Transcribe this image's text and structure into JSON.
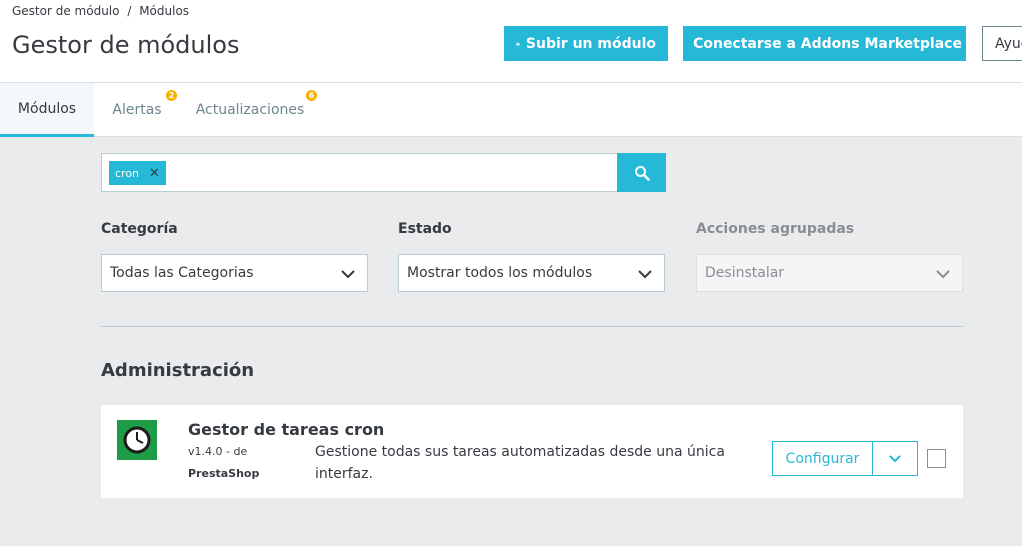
{
  "breadcrumb": [
    "Gestor de módulo",
    "/",
    "Módulos"
  ],
  "header": {
    "title": "Gestor de módulos",
    "upload_label": "Subir un módulo",
    "addons_label": "Conectarse a Addons Marketplace",
    "help_label": "Ayuda"
  },
  "tabs": [
    {
      "label": "Módulos",
      "active": true
    },
    {
      "label": "Alertas",
      "badge": "2"
    },
    {
      "label": "Actualizaciones",
      "badge": "6"
    }
  ],
  "search": {
    "tag": "cron",
    "icon": "search-icon"
  },
  "filters": {
    "category": {
      "label": "Categoría",
      "value": "Todas las Categorias"
    },
    "status": {
      "label": "Estado",
      "value": "Mostrar todos los módulos"
    },
    "bulk": {
      "label": "Acciones agrupadas",
      "value": "Desinstalar",
      "disabled": true
    }
  },
  "section": {
    "title": "Administración"
  },
  "module": {
    "name": "Gestor de tareas cron",
    "version": "v1.4.0 - de",
    "author": "PrestaShop",
    "description": "Gestione todas sus tareas automatizadas desde una única interfaz.",
    "configure_label": "Configurar",
    "logo_icon": "clock-icon"
  },
  "colors": {
    "accent": "#25b9d7",
    "badge": "#fab000",
    "logo_bg": "#1f9c46"
  }
}
